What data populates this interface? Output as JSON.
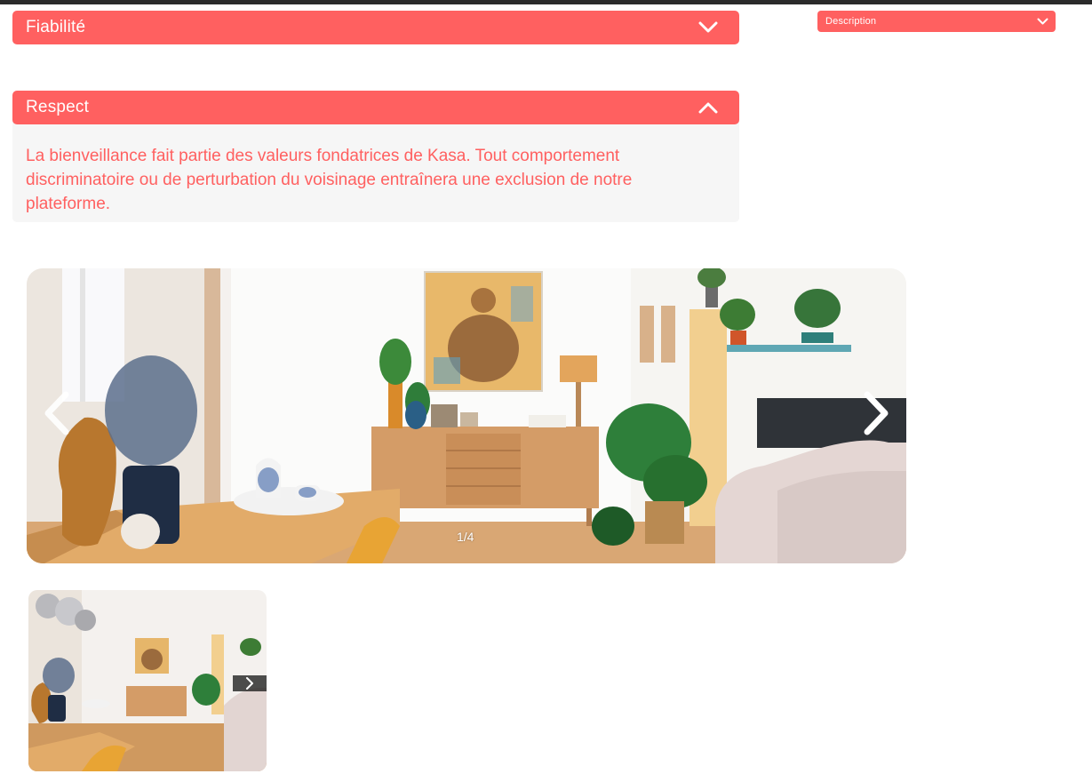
{
  "collapses": {
    "fiabilite": {
      "title": "Fiabilité",
      "state": "closed"
    },
    "respect": {
      "title": "Respect",
      "state": "open",
      "body": "La bienveillance fait partie des valeurs fondatrices de Kasa. Tout comportement discriminatoire ou de perturbation du voisinage entraînera une exclusion de notre plateforme."
    },
    "description": {
      "title": "Description",
      "state": "closed"
    }
  },
  "carousel": {
    "counter": "1/4",
    "current": 1,
    "total": 4
  },
  "colors": {
    "accent": "#FF6060",
    "panel_bg": "#F6F6F6",
    "text_on_accent": "#FFFFFF"
  },
  "icons": {
    "collapse_closed": "chevron-down-icon",
    "collapse_open": "chevron-up-icon",
    "carousel_prev": "chevron-left-icon",
    "carousel_next": "chevron-right-icon"
  }
}
